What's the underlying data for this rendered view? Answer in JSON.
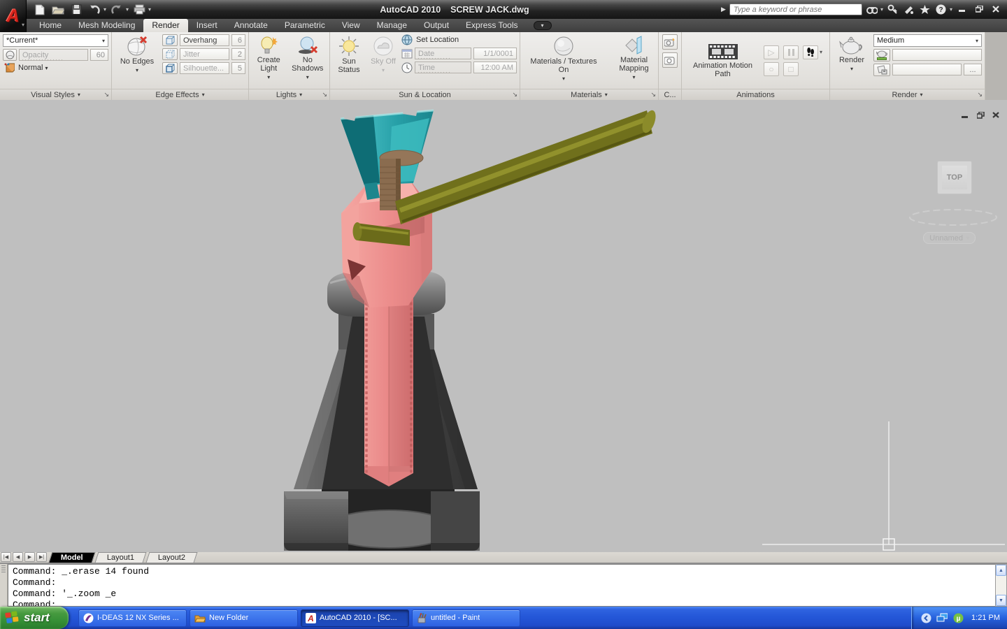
{
  "app": {
    "title": "AutoCAD 2010    SCREW JACK.dwg",
    "search_placeholder": "Type a keyword or phrase"
  },
  "ribbon_tabs": [
    {
      "label": "Home",
      "active": false
    },
    {
      "label": "Mesh Modeling",
      "active": false
    },
    {
      "label": "Render",
      "active": true
    },
    {
      "label": "Insert",
      "active": false
    },
    {
      "label": "Annotate",
      "active": false
    },
    {
      "label": "Parametric",
      "active": false
    },
    {
      "label": "View",
      "active": false
    },
    {
      "label": "Manage",
      "active": false
    },
    {
      "label": "Output",
      "active": false
    },
    {
      "label": "Express Tools",
      "active": false
    }
  ],
  "panels": {
    "visual_styles": {
      "label": "Visual Styles",
      "current_style": "*Current*",
      "opacity_label": "Opacity",
      "opacity_value": "60",
      "face_mode": "Normal"
    },
    "edge_effects": {
      "label": "Edge Effects",
      "no_edges_label": "No Edges",
      "rows": [
        {
          "name": "Overhang",
          "value": "6"
        },
        {
          "name": "Jitter",
          "value": "2"
        },
        {
          "name": "Silhouette...",
          "value": "5"
        }
      ]
    },
    "lights": {
      "label": "Lights",
      "create_light": "Create Light",
      "no_shadows": "No Shadows"
    },
    "sun_location": {
      "label": "Sun & Location",
      "sun_status": "Sun Status",
      "sky_off": "Sky Off",
      "set_location": "Set Location",
      "date_label": "Date",
      "date_value": "1/1/0001",
      "time_label": "Time",
      "time_value": "12:00 AM"
    },
    "materials": {
      "label": "Materials",
      "textures_on": "Materials / Textures On",
      "mapping": "Material Mapping"
    },
    "cameras": {
      "label": "C..."
    },
    "animations": {
      "label": "Animations",
      "motion_path": "Animation Motion Path"
    },
    "render": {
      "label": "Render",
      "render_button": "Render",
      "quality": "Medium",
      "more_label": "..."
    }
  },
  "viewport": {
    "viewcube_face": "TOP",
    "named_view_label": "Unnamed"
  },
  "layout_bar": {
    "tabs": [
      {
        "label": "Model",
        "active": true
      },
      {
        "label": "Layout1",
        "active": false
      },
      {
        "label": "Layout2",
        "active": false
      }
    ]
  },
  "command": {
    "lines": [
      "Command: _.erase 14 found",
      "Command:",
      "Command: '_.zoom _e",
      "Command:"
    ]
  },
  "taskbar": {
    "start_label": "start",
    "tasks": [
      {
        "label": "I-DEAS 12 NX Series ...",
        "active": false
      },
      {
        "label": "New Folder",
        "active": false
      },
      {
        "label": "AutoCAD 2010 - [SC...",
        "active": true
      },
      {
        "label": "untitled - Paint",
        "active": false
      }
    ],
    "clock": "1:21 PM"
  },
  "colors": {
    "taskbar_blue": "#2457d8",
    "start_green": "#379137",
    "viewport_gray": "#bfbfbf",
    "model_pink": "#ec8c8b",
    "model_teal": "#2aa4ab",
    "model_olive": "#70701c",
    "model_base_gray": "#4c4c4c",
    "logo_red": "#d9251d"
  }
}
